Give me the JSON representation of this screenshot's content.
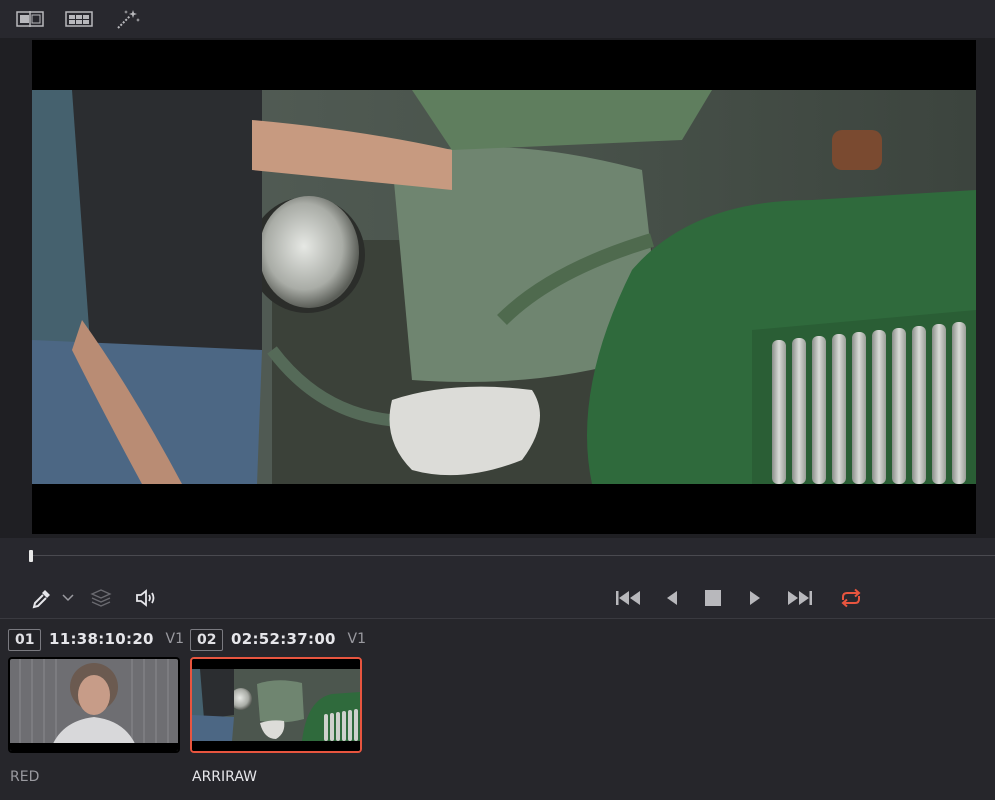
{
  "toolbar": {
    "icons": [
      "split-view-icon",
      "grid-view-icon",
      "magic-wand-icon"
    ]
  },
  "viewer": {
    "scrub_position": 0.0
  },
  "transport": {
    "left_icons": [
      "eyedropper-icon",
      "dropdown-chevron-icon",
      "layers-icon",
      "speaker-icon"
    ],
    "buttons": [
      "skip-to-start-icon",
      "step-back-icon",
      "stop-icon",
      "play-icon",
      "skip-to-end-icon",
      "loop-icon"
    ],
    "loop_color": "#e8553f"
  },
  "clips": [
    {
      "number": "01",
      "timecode": "11:38:10:20",
      "track": "V1",
      "name": "RED",
      "selected": false
    },
    {
      "number": "02",
      "timecode": "02:52:37:00",
      "track": "V1",
      "name": "ARRIRAW",
      "selected": true
    }
  ],
  "colors": {
    "selection": "#e8553f",
    "background": "#28282e"
  }
}
